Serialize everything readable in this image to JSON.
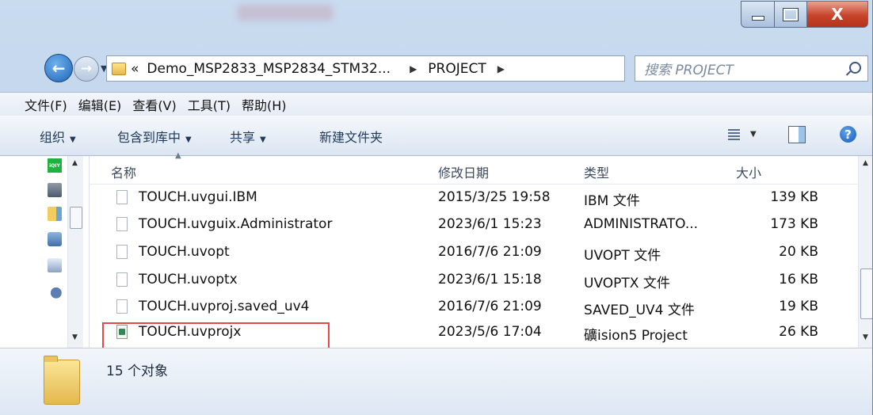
{
  "window": {
    "controls": {
      "minimize": "_",
      "maximize": "□",
      "close": "X"
    }
  },
  "address_bar": {
    "prefix": "«",
    "path_segment_1": "Demo_MSP2833_MSP2834_STM32...",
    "path_segment_2": "PROJECT",
    "separator": "▶"
  },
  "search": {
    "placeholder": "搜索 PROJECT"
  },
  "menu": [
    "文件(F)",
    "编辑(E)",
    "查看(V)",
    "工具(T)",
    "帮助(H)"
  ],
  "toolbar": {
    "organize": "组织",
    "include_library": "包含到库中",
    "share": "共享",
    "new_folder": "新建文件夹",
    "help": "?"
  },
  "columns": [
    "名称",
    "修改日期",
    "类型",
    "大小"
  ],
  "nav_pane": {
    "iqiyi_label": "iQIY"
  },
  "files": [
    {
      "name": "TOUCH.uvgui.IBM",
      "date": "2015/3/25 19:58",
      "type": "IBM 文件",
      "size": "139 KB"
    },
    {
      "name": "TOUCH.uvguix.Administrator",
      "date": "2023/6/1 15:23",
      "type": "ADMINISTRATO...",
      "size": "173 KB"
    },
    {
      "name": "TOUCH.uvopt",
      "date": "2016/7/6 21:09",
      "type": "UVOPT 文件",
      "size": "20 KB"
    },
    {
      "name": "TOUCH.uvoptx",
      "date": "2023/6/1 15:18",
      "type": "UVOPTX 文件",
      "size": "16 KB"
    },
    {
      "name": "TOUCH.uvproj.saved_uv4",
      "date": "2016/7/6 21:09",
      "type": "SAVED_UV4 文件",
      "size": "19 KB"
    },
    {
      "name": "TOUCH.uvprojx",
      "date": "2023/5/6 17:04",
      "type": "礦ision5 Project",
      "size": "26 KB"
    }
  ],
  "status": {
    "item_count": "15 个对象"
  },
  "colors": {
    "highlight_border": "#e4484b",
    "close_button": "#c8432a"
  }
}
